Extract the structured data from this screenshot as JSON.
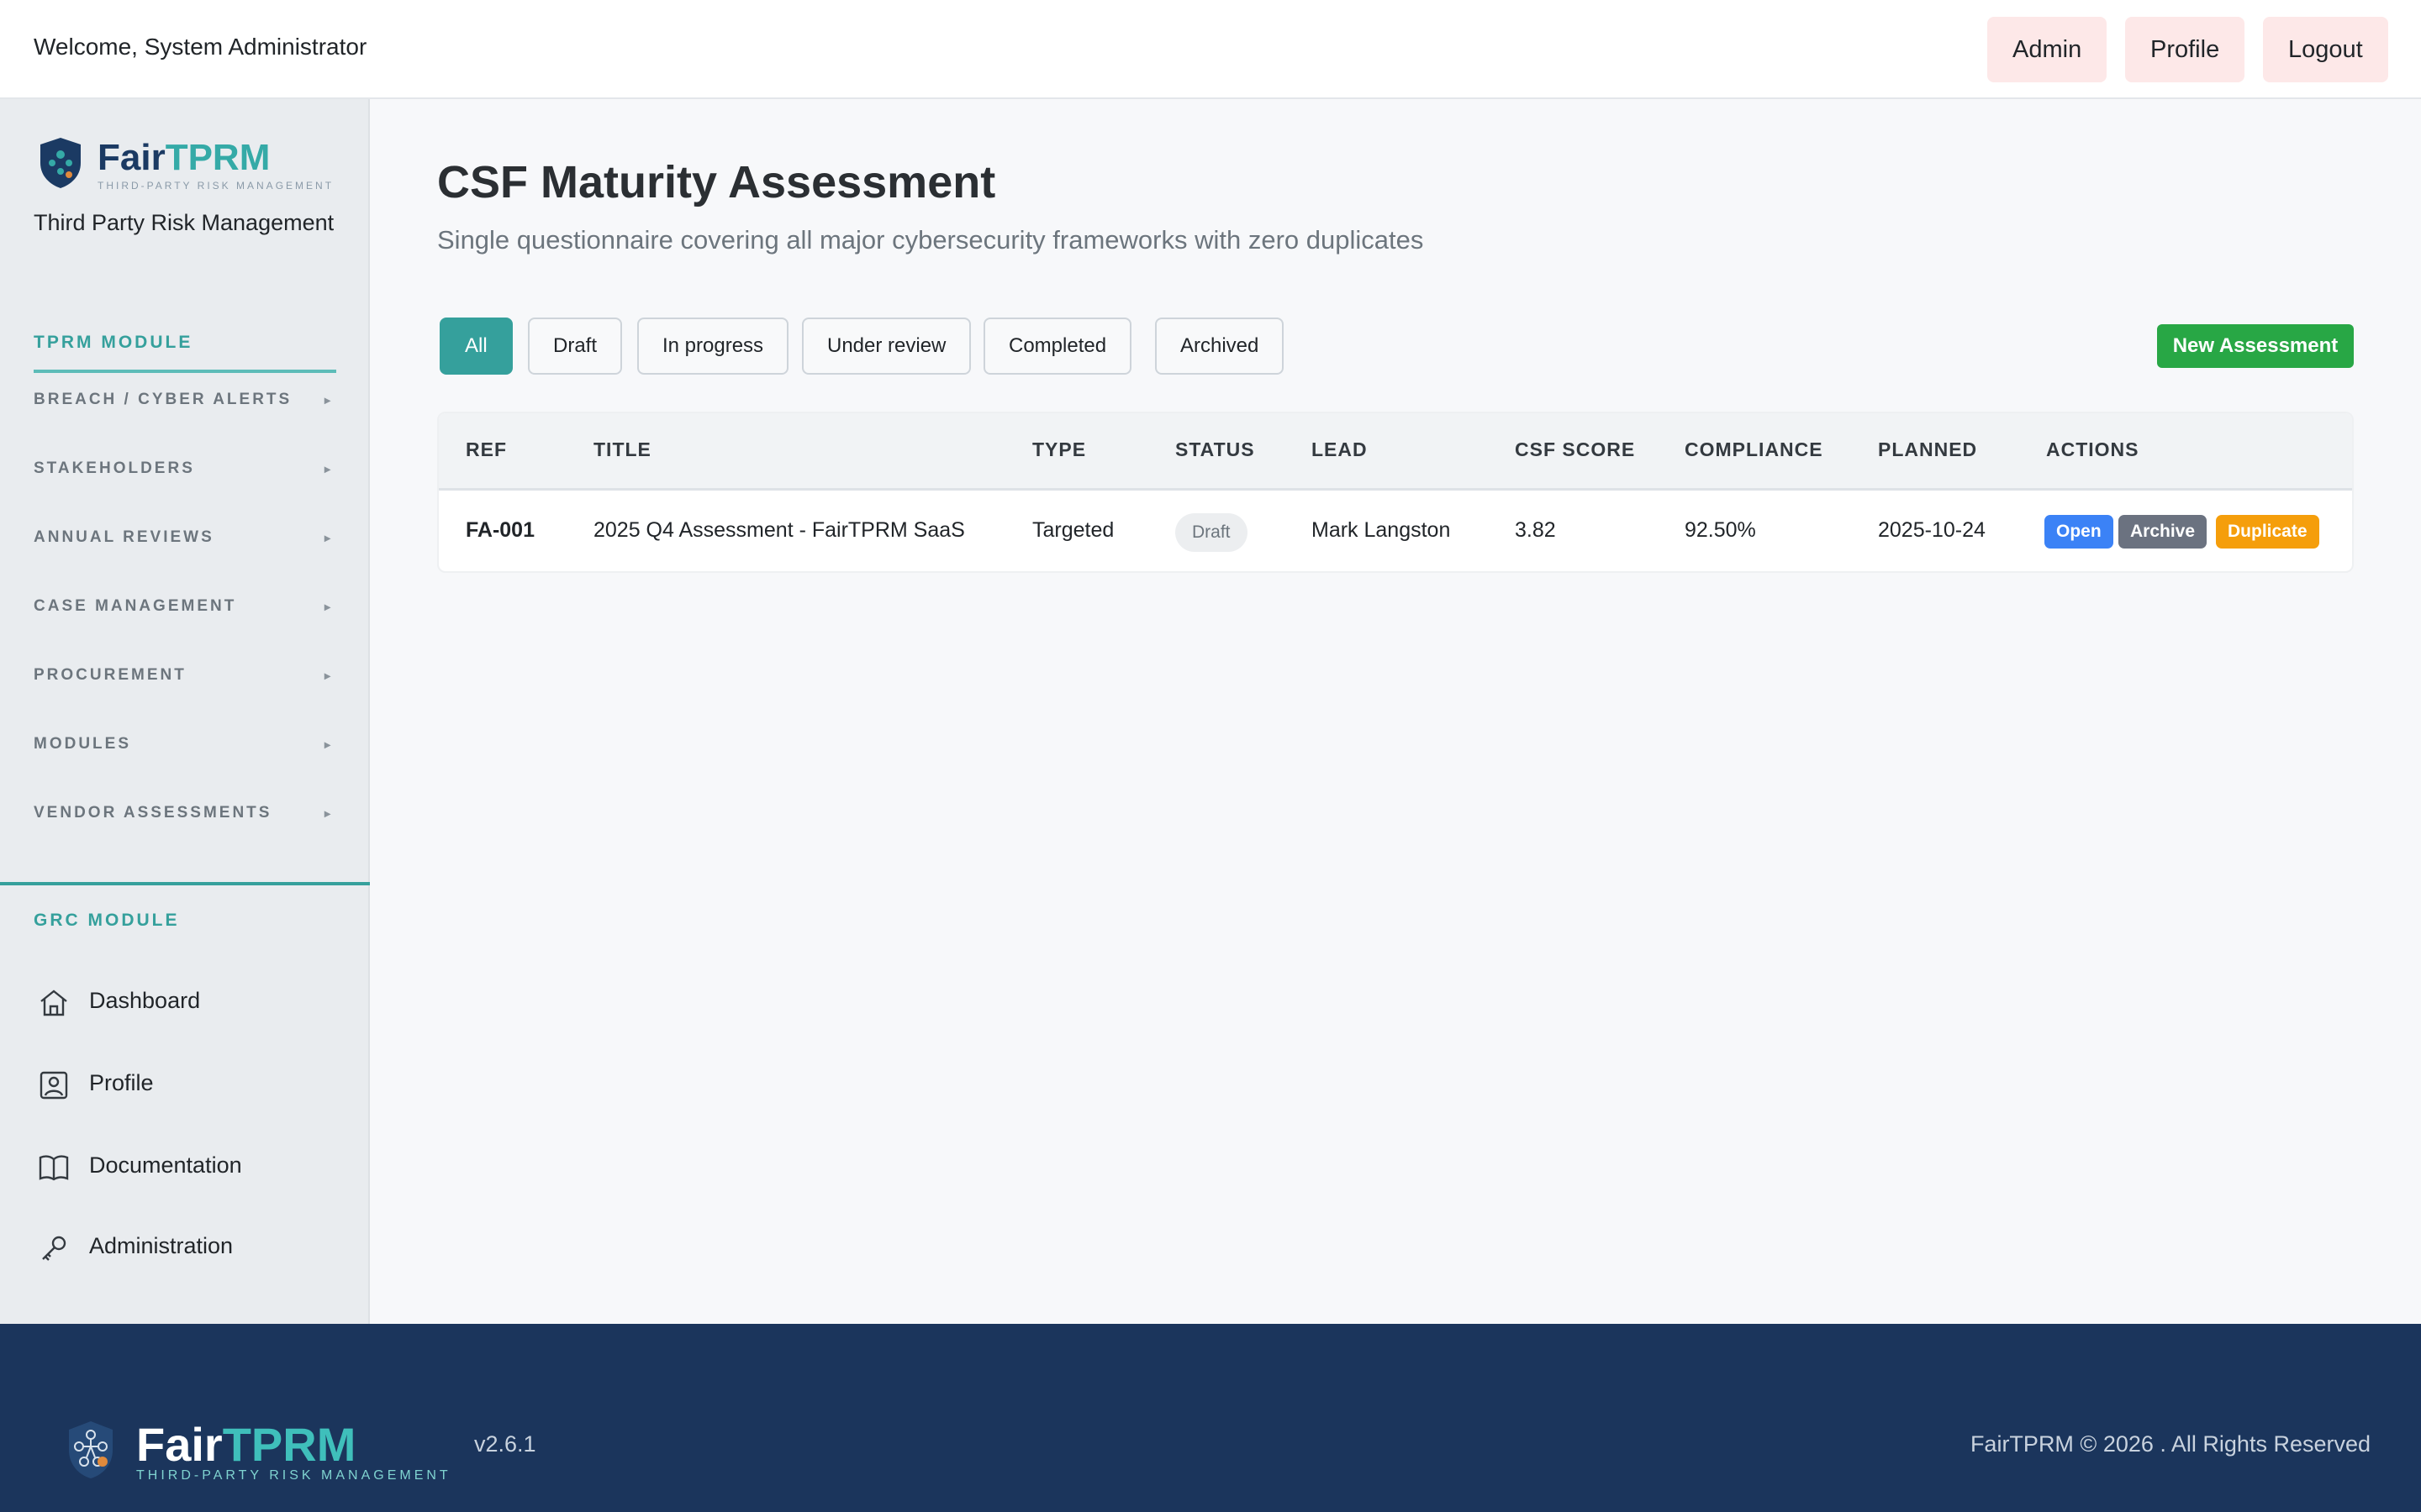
{
  "topbar": {
    "welcome": "Welcome, System Administrator",
    "buttons": {
      "admin": "Admin",
      "profile": "Profile",
      "logout": "Logout"
    }
  },
  "sidebar": {
    "logo": {
      "fair": "Fair",
      "tprm": "TPRM",
      "tagline": "THIRD-PARTY RISK MANAGEMENT"
    },
    "subtitle": "Third Party Risk Management",
    "tprm_module": {
      "heading": "TPRM MODULE",
      "items": [
        {
          "label": "BREACH / CYBER ALERTS",
          "arrow": "▸"
        },
        {
          "label": "STAKEHOLDERS",
          "arrow": "▸"
        },
        {
          "label": "ANNUAL REVIEWS",
          "arrow": "▸"
        },
        {
          "label": "CASE MANAGEMENT",
          "arrow": "▸"
        },
        {
          "label": "PROCUREMENT",
          "arrow": "▸"
        },
        {
          "label": "MODULES",
          "arrow": "▸"
        },
        {
          "label": "VENDOR ASSESSMENTS",
          "arrow": "▸"
        }
      ]
    },
    "grc_module": {
      "heading": "GRC MODULE",
      "items": [
        {
          "label": "Dashboard",
          "icon": "home-icon"
        },
        {
          "label": "Profile",
          "icon": "user-square-icon"
        },
        {
          "label": "Documentation",
          "icon": "book-icon"
        },
        {
          "label": "Administration",
          "icon": "key-icon"
        }
      ]
    }
  },
  "main": {
    "title": "CSF Maturity Assessment",
    "subtitle": "Single questionnaire covering all major cybersecurity frameworks with zero duplicates",
    "filters": [
      "All",
      "Draft",
      "In progress",
      "Under review",
      "Completed",
      "Archived"
    ],
    "active_filter": "All",
    "new_button": "New Assessment",
    "table": {
      "headers": [
        "REF",
        "TITLE",
        "TYPE",
        "STATUS",
        "LEAD",
        "CSF SCORE",
        "COMPLIANCE",
        "PLANNED",
        "ACTIONS"
      ],
      "rows": [
        {
          "ref": "FA-001",
          "title": "2025 Q4 Assessment - FairTPRM SaaS",
          "type": "Targeted",
          "status": "Draft",
          "lead": "Mark Langston",
          "csf_score": "3.82",
          "compliance": "92.50%",
          "planned": "2025-10-24",
          "actions": [
            "Open",
            "Archive",
            "Duplicate"
          ]
        }
      ]
    }
  },
  "footer": {
    "brand": {
      "fair": "Fair",
      "tprm": "TPRM",
      "tagline": "THIRD-PARTY RISK MANAGEMENT"
    },
    "version": "v2.6.1",
    "copyright": "FairTPRM ©  2026 .  All Rights Reserved"
  },
  "colors": {
    "accent": "#35a09c",
    "brand_navy": "#1b355c",
    "success": "#28a745",
    "open_action": "#3b82f6",
    "archive_action": "#6b7280",
    "duplicate_action": "#f59e0b",
    "topbar_button_bg": "#fde8e8"
  }
}
